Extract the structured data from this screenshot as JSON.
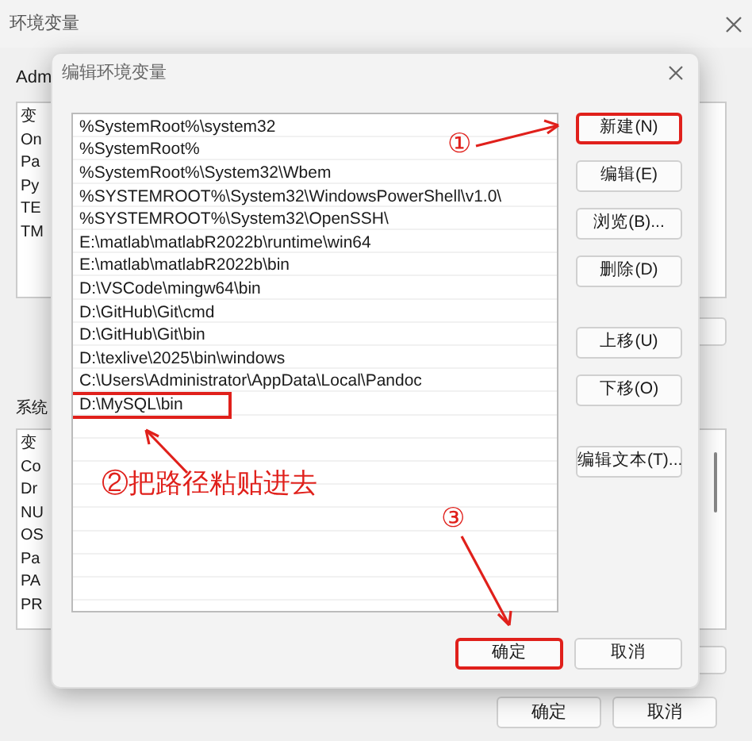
{
  "window": {
    "title": "环境变量",
    "user_label": "Adm",
    "user_vars": [
      "变",
      "On",
      "Pa",
      "Py",
      "TE",
      "TM"
    ],
    "system_label": "系统",
    "system_vars": [
      "变",
      "Co",
      "Dr",
      "NU",
      "OS",
      "Pa",
      "PA",
      "PR"
    ],
    "buttons": [
      "确定",
      "取消"
    ]
  },
  "dialog": {
    "title": "编辑环境变量",
    "paths": [
      {
        "text": "%SystemRoot%\\system32",
        "highlighted": false
      },
      {
        "text": "%SystemRoot%",
        "highlighted": false
      },
      {
        "text": "%SystemRoot%\\System32\\Wbem",
        "highlighted": false
      },
      {
        "text": "%SYSTEMROOT%\\System32\\WindowsPowerShell\\v1.0\\",
        "highlighted": false
      },
      {
        "text": "%SYSTEMROOT%\\System32\\OpenSSH\\",
        "highlighted": false
      },
      {
        "text": "E:\\matlab\\matlabR2022b\\runtime\\win64",
        "highlighted": false
      },
      {
        "text": "E:\\matlab\\matlabR2022b\\bin",
        "highlighted": false
      },
      {
        "text": "D:\\VSCode\\mingw64\\bin",
        "highlighted": false
      },
      {
        "text": "D:\\GitHub\\Git\\cmd",
        "highlighted": false
      },
      {
        "text": "D:\\GitHub\\Git\\bin",
        "highlighted": false
      },
      {
        "text": "D:\\texlive\\2025\\bin\\windows",
        "highlighted": false
      },
      {
        "text": "C:\\Users\\Administrator\\AppData\\Local\\Pandoc",
        "highlighted": false
      },
      {
        "text": "D:\\MySQL\\bin",
        "highlighted": true
      }
    ],
    "side_buttons": [
      {
        "label": "新建(N)",
        "highlighted": true
      },
      {
        "label": "编辑(E)",
        "highlighted": false
      },
      {
        "label": "浏览(B)...",
        "highlighted": false
      },
      {
        "label": "删除(D)",
        "highlighted": false
      },
      {
        "label": "上移(U)",
        "highlighted": false
      },
      {
        "label": "下移(O)",
        "highlighted": false
      },
      {
        "label": "编辑文本(T)...",
        "highlighted": false
      }
    ],
    "footer_buttons": [
      {
        "label": "确定",
        "highlighted": true
      },
      {
        "label": "取消",
        "highlighted": false
      }
    ]
  },
  "annotations": [
    {
      "text": "①"
    },
    {
      "text": "②把路径粘贴进去"
    },
    {
      "text": "③"
    }
  ]
}
